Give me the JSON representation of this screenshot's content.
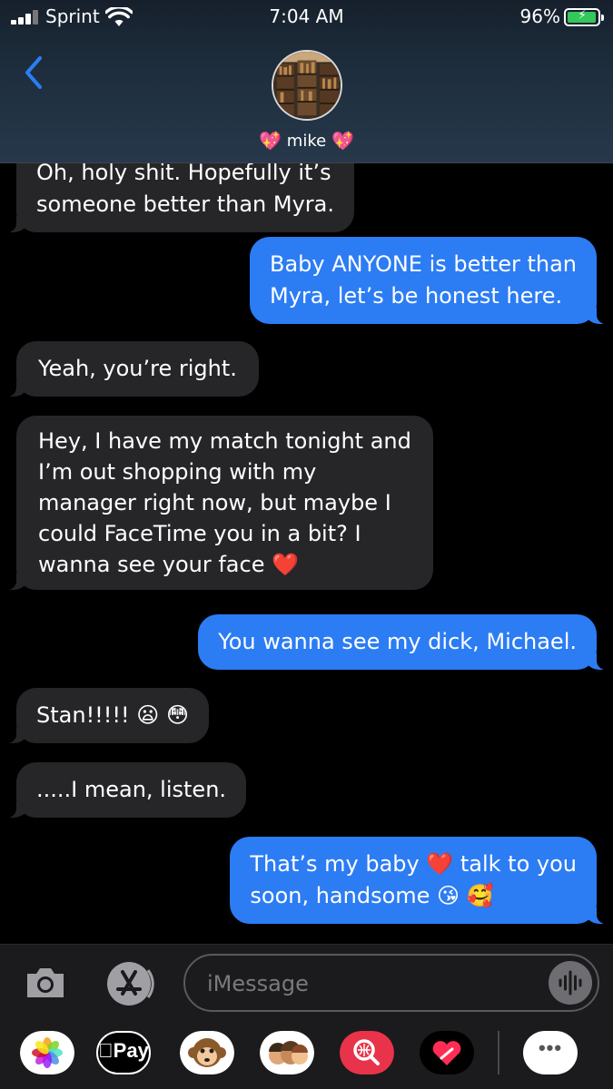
{
  "status": {
    "carrier": "Sprint",
    "time": "7:04 AM",
    "battery": "96%",
    "battery_level": 0.96
  },
  "header": {
    "contact_name": "mike",
    "name_emoji_left": "💖",
    "name_emoji_right": "💖"
  },
  "messages": [
    {
      "direction": "incoming",
      "text": "Oh, holy shit. Hopefully it’s\nsomeone better than Myra."
    },
    {
      "direction": "outgoing",
      "text": "Baby ANYONE is better than\nMyra, let’s be honest here."
    },
    {
      "direction": "incoming",
      "text": "Yeah, you’re right."
    },
    {
      "direction": "incoming",
      "text": "Hey, I have my match tonight and\nI’m out shopping with my\nmanager right now, but maybe I\ncould FaceTime you in a bit? I\nwanna see your face ❤️"
    },
    {
      "direction": "outgoing",
      "text": "You wanna see my dick, Michael."
    },
    {
      "direction": "incoming",
      "text": "Stan!!!!! 😦 😳"
    },
    {
      "direction": "incoming",
      "text": ".....I mean, listen."
    },
    {
      "direction": "outgoing",
      "text": "That’s my baby ❤️ talk to you\nsoon, handsome 😘 🥰"
    }
  ],
  "composer": {
    "placeholder": "iMessage"
  },
  "app_drawer": {
    "apple_pay_label": "Pay",
    "more_label": "•••"
  }
}
